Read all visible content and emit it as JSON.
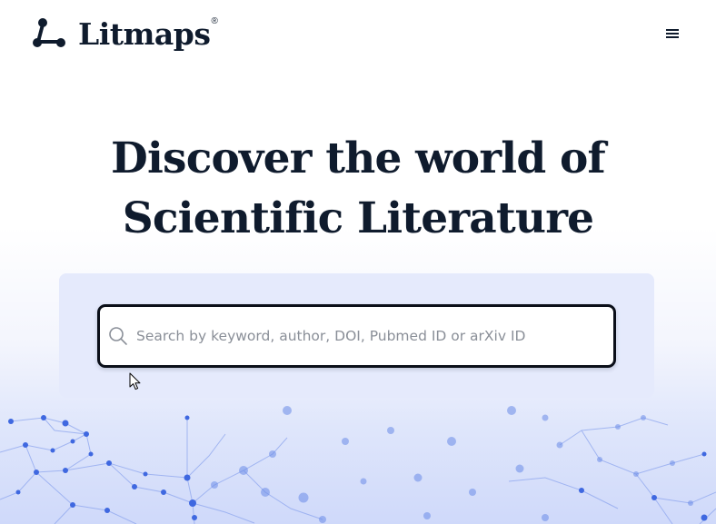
{
  "brand": {
    "name": "Litmaps",
    "registered_mark": "®"
  },
  "header": {
    "menu_icon": "hamburger-menu-icon"
  },
  "hero": {
    "title_line1": "Discover the world of",
    "title_line2": "Scientific Literature"
  },
  "search": {
    "placeholder": "Search by keyword, author, DOI, Pubmed ID or arXiv ID",
    "value": "",
    "icon": "search-icon"
  },
  "colors": {
    "text_dark": "#0f1b2d",
    "panel": "#e5eafc",
    "network_node": "#3f68e0",
    "network_line": "#8ea6ee"
  }
}
